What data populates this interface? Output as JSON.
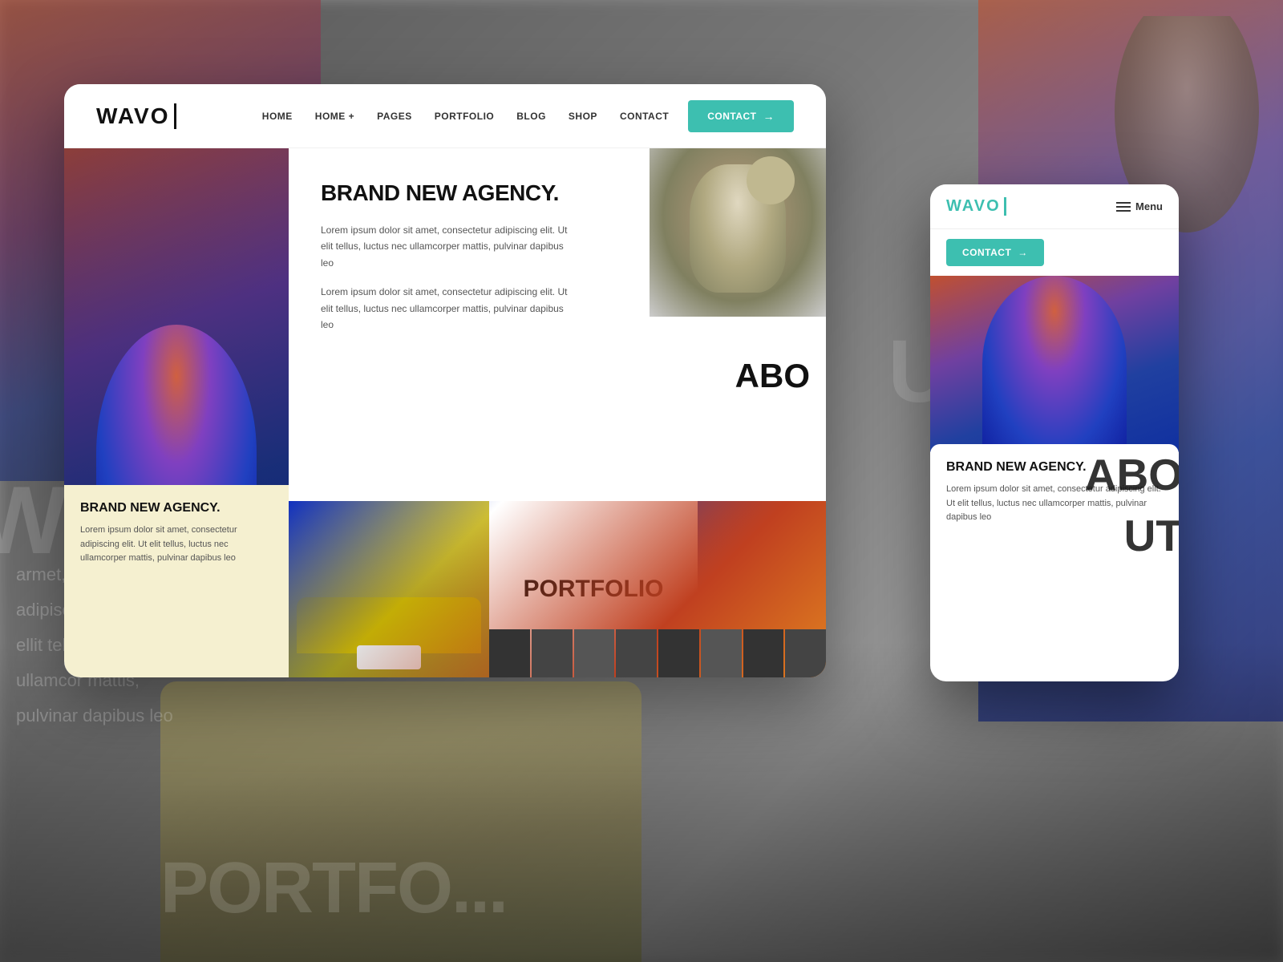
{
  "background": {
    "color": "#888888"
  },
  "desktop_card": {
    "nav": {
      "logo": "WAVO",
      "links": [
        {
          "label": "HOME",
          "id": "home"
        },
        {
          "label": "HOME +",
          "id": "home-plus"
        },
        {
          "label": "PAGES",
          "id": "pages"
        },
        {
          "label": "PORTFOLIO",
          "id": "portfolio"
        },
        {
          "label": "BLOG",
          "id": "blog"
        },
        {
          "label": "SHOP",
          "id": "shop"
        },
        {
          "label": "CONTACT",
          "id": "contact"
        }
      ],
      "contact_button": "CONTACT",
      "contact_arrow": "→"
    },
    "hero": {
      "title": "BRAND NEW AGENCY.",
      "desc1": "Lorem ipsum dolor sit amet, consectetur adipiscing elit. Ut elit tellus, luctus nec ullamcorper mattis, pulvinar dapibus leo",
      "desc2": "Lorem ipsum dolor sit amet, consectetur adipiscing elit. Ut elit tellus, luctus nec ullamcorper mattis, pulvinar dapibus leo"
    },
    "work_badge": "work-x6",
    "about_partial": "ABO",
    "bottom_left": {
      "title": "BRAND NEW AGENCY.",
      "desc": "Lorem ipsum dolor sit amet, consectetur adipiscing elit. Ut elit tellus, luctus nec ullamcorper mattis, pulvinar dapibus leo"
    },
    "portfolio_label": "PORTFOLIO"
  },
  "mobile_card": {
    "logo": "WAVO",
    "menu_label": "Menu",
    "contact_button": "CONTACT",
    "contact_arrow": "→",
    "partial_text": "ABO...UT",
    "content_card": {
      "title": "BRAND NEW AGENCY.",
      "desc": "Lorem ipsum dolor sit amet, consectetur adipiscing elit. Ut elit tellus, luctus nec ullamcorper mattis, pulvinar dapibus leo"
    }
  },
  "bg_texts": {
    "agency": "W AG",
    "portfolio": "PORTFO...",
    "about_right": "UT"
  },
  "colors": {
    "teal": "#3dbfb0",
    "dark": "#111111",
    "light_bg": "#f5f0d0",
    "text_secondary": "#555555"
  }
}
